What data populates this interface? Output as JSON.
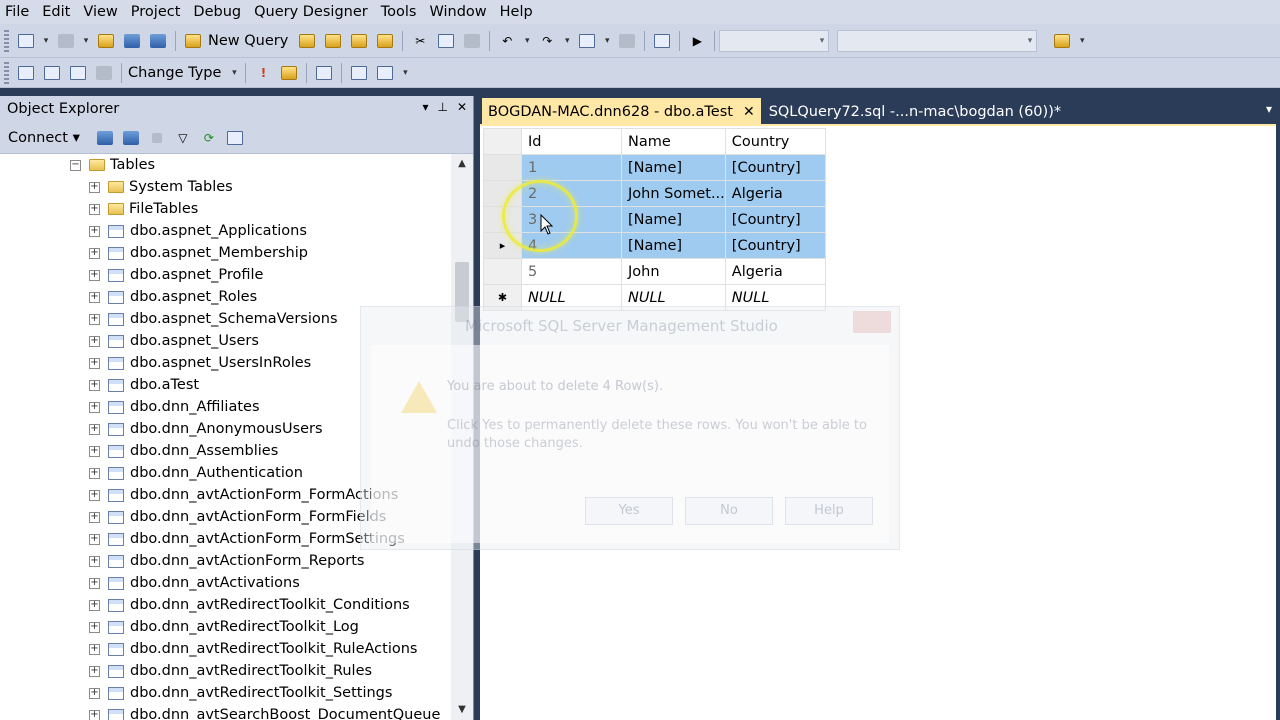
{
  "menu": [
    "File",
    "Edit",
    "View",
    "Project",
    "Debug",
    "Query Designer",
    "Tools",
    "Window",
    "Help"
  ],
  "toolbar": {
    "new_query_label": "New Query",
    "change_type_label": "Change Type"
  },
  "object_explorer": {
    "title": "Object Explorer",
    "connect_label": "Connect",
    "tables_folder": "Tables",
    "items": [
      {
        "label": "System Tables",
        "kind": "folder"
      },
      {
        "label": "FileTables",
        "kind": "folder"
      },
      {
        "label": "dbo.aspnet_Applications",
        "kind": "table"
      },
      {
        "label": "dbo.aspnet_Membership",
        "kind": "table"
      },
      {
        "label": "dbo.aspnet_Profile",
        "kind": "table"
      },
      {
        "label": "dbo.aspnet_Roles",
        "kind": "table"
      },
      {
        "label": "dbo.aspnet_SchemaVersions",
        "kind": "table"
      },
      {
        "label": "dbo.aspnet_Users",
        "kind": "table"
      },
      {
        "label": "dbo.aspnet_UsersInRoles",
        "kind": "table"
      },
      {
        "label": "dbo.aTest",
        "kind": "table"
      },
      {
        "label": "dbo.dnn_Affiliates",
        "kind": "table"
      },
      {
        "label": "dbo.dnn_AnonymousUsers",
        "kind": "table"
      },
      {
        "label": "dbo.dnn_Assemblies",
        "kind": "table"
      },
      {
        "label": "dbo.dnn_Authentication",
        "kind": "table"
      },
      {
        "label": "dbo.dnn_avtActionForm_FormActions",
        "kind": "table"
      },
      {
        "label": "dbo.dnn_avtActionForm_FormFields",
        "kind": "table"
      },
      {
        "label": "dbo.dnn_avtActionForm_FormSettings",
        "kind": "table"
      },
      {
        "label": "dbo.dnn_avtActionForm_Reports",
        "kind": "table"
      },
      {
        "label": "dbo.dnn_avtActivations",
        "kind": "table"
      },
      {
        "label": "dbo.dnn_avtRedirectToolkit_Conditions",
        "kind": "table"
      },
      {
        "label": "dbo.dnn_avtRedirectToolkit_Log",
        "kind": "table"
      },
      {
        "label": "dbo.dnn_avtRedirectToolkit_RuleActions",
        "kind": "table"
      },
      {
        "label": "dbo.dnn_avtRedirectToolkit_Rules",
        "kind": "table"
      },
      {
        "label": "dbo.dnn_avtRedirectToolkit_Settings",
        "kind": "table"
      },
      {
        "label": "dbo.dnn_avtSearchBoost_DocumentQueue",
        "kind": "table"
      }
    ]
  },
  "tabs": [
    {
      "label": "BOGDAN-MAC.dnn628 - dbo.aTest",
      "active": true
    },
    {
      "label": "SQLQuery72.sql -...n-mac\\bogdan (60))*",
      "active": false
    }
  ],
  "grid": {
    "columns": [
      "Id",
      "Name",
      "Country"
    ],
    "rows": [
      {
        "marker": "",
        "id": "1",
        "name": "[Name]",
        "country": "[Country]",
        "selected": true
      },
      {
        "marker": "",
        "id": "2",
        "name": "John Somet...",
        "country": "Algeria",
        "selected": true
      },
      {
        "marker": "",
        "id": "3",
        "name": "[Name]",
        "country": "[Country]",
        "selected": true
      },
      {
        "marker": "▸",
        "id": "4",
        "name": "[Name]",
        "country": "[Country]",
        "selected": true
      },
      {
        "marker": "",
        "id": "5",
        "name": "John",
        "country": "Algeria",
        "selected": false
      },
      {
        "marker": "✱",
        "id": "NULL",
        "name": "NULL",
        "country": "NULL",
        "selected": false
      }
    ]
  },
  "dialog": {
    "title": "Microsoft SQL Server Management Studio",
    "message": "You are about to delete 4 Row(s).",
    "detail": "Click Yes to permanently delete these rows. You won't be able to undo those changes.",
    "yes_label": "Yes",
    "no_label": "No",
    "help_label": "Help"
  },
  "colors": {
    "ide_dark": "#2b3c59",
    "toolbar": "#cfd6e5",
    "active_tab": "#ffe8a6",
    "selection": "#9fcbf0"
  }
}
